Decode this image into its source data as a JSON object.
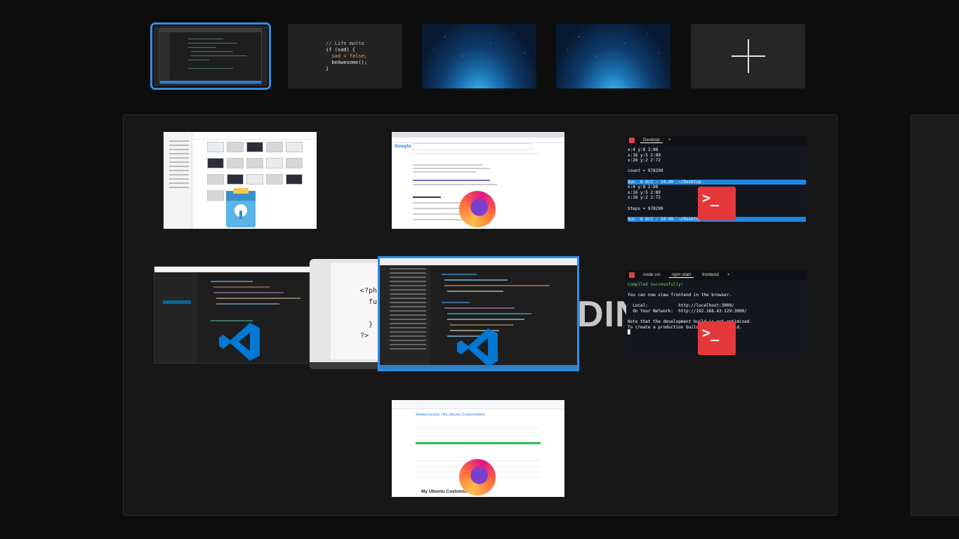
{
  "workspace_strip": {
    "workspace_1": "Workspace 1 (active)",
    "workspace_2_code": [
      "// Life motto",
      "if (sad) {",
      "  sad = false;",
      "  beAwesome();",
      "}"
    ],
    "new_workspace_label": "+"
  },
  "files_window": {
    "sidebar": [
      "Home",
      "Desktop",
      "Videos",
      "Music",
      "Pictures",
      "Documents",
      "Downloads",
      "Trash",
      "Computer",
      "System Disk",
      "Network",
      "Android"
    ]
  },
  "chrome_window": {
    "logo": "Google",
    "query": "remedies for annoying cough",
    "result_title": "4 Home Remedies for Cough | Healthline",
    "section": "People also ask"
  },
  "terminal_1": {
    "tab": "Desktop",
    "lines": [
      {
        "text": "x:4 y:8 2:88",
        "cls": "w"
      },
      {
        "text": "x:16 y:5 2:89",
        "cls": "w"
      },
      {
        "text": "x:26 y:2 2:72",
        "cls": "w"
      },
      {
        "text": "",
        "cls": "w"
      },
      {
        "text": "count = 978299",
        "cls": "w"
      },
      {
        "text": "",
        "cls": "w"
      },
      {
        "text": "Sun  6 Oct - 14:40  ~/Desktop",
        "cls": "seg"
      },
      {
        "text": "x:4 y:8 2:88",
        "cls": "w"
      },
      {
        "text": "x:16 y:5 2:89",
        "cls": "w"
      },
      {
        "text": "x:26 y:2 2:72",
        "cls": "w"
      },
      {
        "text": "",
        "cls": "w"
      },
      {
        "text": "Steps = 978299",
        "cls": "w"
      },
      {
        "text": "",
        "cls": "w"
      },
      {
        "text": "Sun  6 Oct - 14:40  ~/Desktop",
        "cls": "seg"
      }
    ]
  },
  "terminal_2": {
    "tabs": [
      "node src",
      "npm start",
      "frontend"
    ],
    "lines": [
      {
        "text": "Compiled successfully!",
        "cls": "g"
      },
      {
        "text": "",
        "cls": "w"
      },
      {
        "text": "You can now view frontend in the browser.",
        "cls": "w"
      },
      {
        "text": "",
        "cls": "w"
      },
      {
        "text": "  Local:            http://localhost:3000/",
        "cls": "w"
      },
      {
        "text": "  On Your Network:  http://192.168.43.129:3000/",
        "cls": "w"
      },
      {
        "text": "",
        "cls": "w"
      },
      {
        "text": "Note that the development build is not optimized.",
        "cls": "w"
      },
      {
        "text": "To create a production build, use yarn build.",
        "cls": "w"
      },
      {
        "text": "█",
        "cls": "w"
      }
    ]
  },
  "laptop_code": "<?php\n  fun\n\n  }\n?>",
  "background_word": "DIN",
  "github_window": {
    "repo": "Satwikchouhan / My_Ubuntu_Customization",
    "readme_title": "My Ubuntu Customization"
  },
  "colors": {
    "accent": "#2f8fe4",
    "terminal_red": "#e5383b",
    "vscode_blue": "#0078d4"
  },
  "icons": [
    "firefox-icon",
    "visual-studio-code-icon",
    "terminal-icon",
    "document-viewer-icon",
    "plus-icon"
  ]
}
